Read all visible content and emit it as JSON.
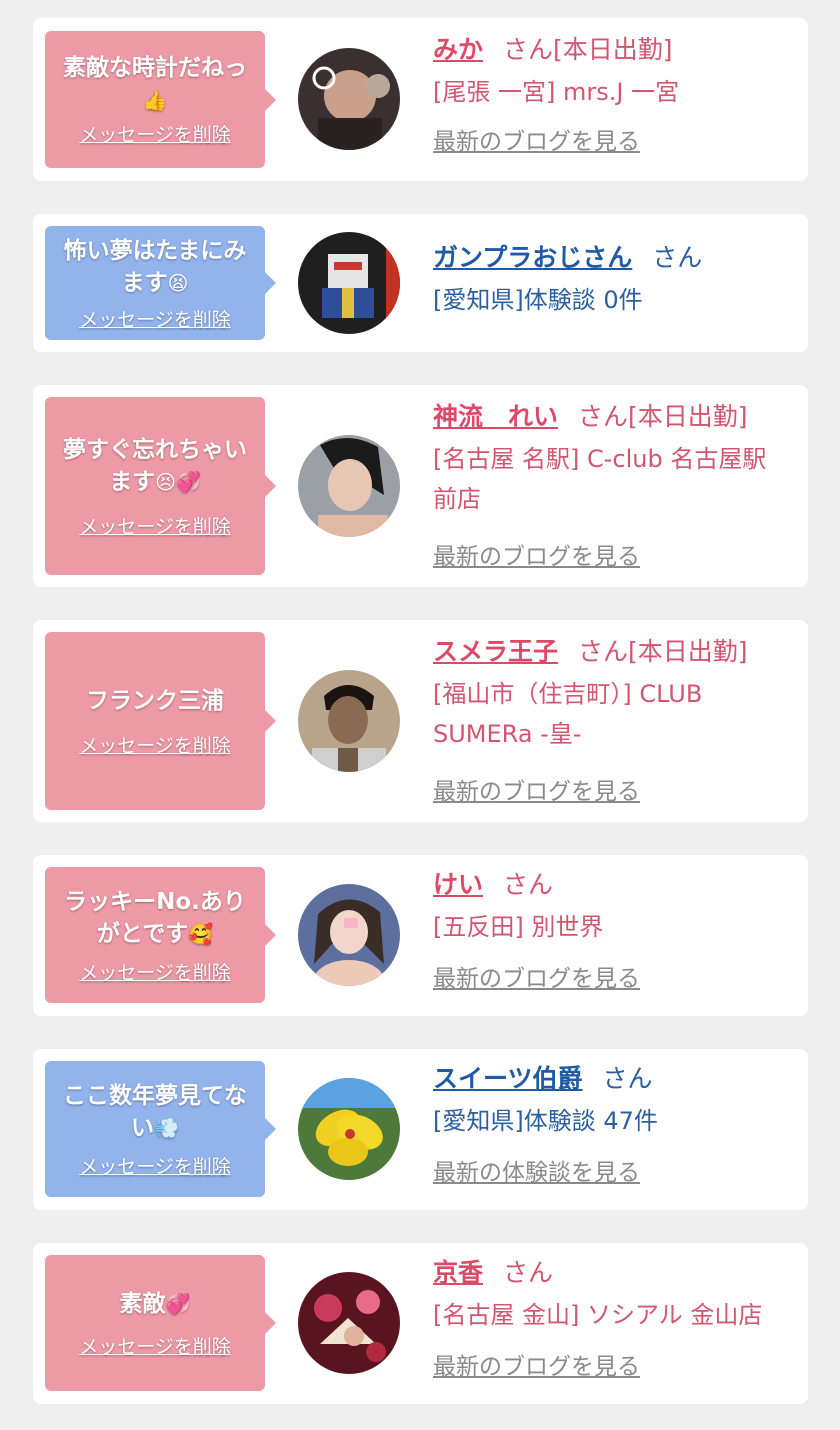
{
  "delete_label": "メッセージを削除",
  "items": [
    {
      "message": "素敵な時計だねっ",
      "emoji": "👍",
      "name": "みか",
      "suffix": "さん[本日出勤]",
      "shop": "[尾張 一宮] mrs.J 一宮",
      "link": "最新のブログを見る"
    },
    {
      "message": "怖い夢はたまにみます",
      "emoji": "😫",
      "name": "ガンプラおじさん",
      "suffix": "さん",
      "shop": "[愛知県]体験談 0件",
      "link": ""
    },
    {
      "message": "夢すぐ忘れちゃいます",
      "emoji": "😣💞",
      "name": "神流　れい",
      "suffix": "さん[本日出勤]",
      "shop": "[名古屋 名駅] C-club 名古屋駅前店",
      "link": "最新のブログを見る"
    },
    {
      "message": "フランク三浦",
      "emoji": "",
      "name": "スメラ王子",
      "suffix": "さん[本日出勤]",
      "shop": "[福山市（住吉町）] CLUB SUMERa -皇-",
      "link": "最新のブログを見る"
    },
    {
      "message": "ラッキーNo.ありがとです",
      "emoji": "🥰",
      "name": "けい",
      "suffix": "さん",
      "shop": "[五反田] 別世界",
      "link": "最新のブログを見る"
    },
    {
      "message": "ここ数年夢見てない",
      "emoji": "💨",
      "name": "スイーツ伯爵",
      "suffix": "さん",
      "shop": "[愛知県]体験談 47件",
      "link": "最新の体験談を見る"
    },
    {
      "message": "素敵",
      "emoji": "💞",
      "name": "京香",
      "suffix": "さん",
      "shop": "[名古屋 金山] ソシアル 金山店",
      "link": "最新のブログを見る"
    }
  ],
  "colors": {
    "pink_bubble": "#ee9aa6",
    "blue_bubble": "#92b3ec",
    "pink_text": "#dc4a68",
    "blue_text": "#1f5aa6",
    "link_gray": "#8a8a8a",
    "background": "#efefef"
  }
}
